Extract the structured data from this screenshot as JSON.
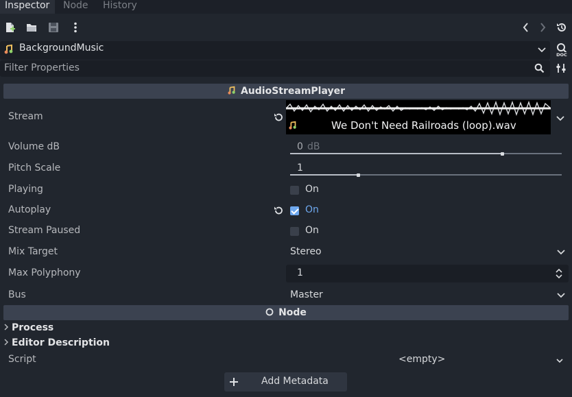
{
  "tabs": [
    {
      "label": "Inspector",
      "active": true
    },
    {
      "label": "Node",
      "active": false
    },
    {
      "label": "History",
      "active": false
    }
  ],
  "node": {
    "name": "BackgroundMusic"
  },
  "filter": {
    "placeholder": "Filter Properties"
  },
  "section_main": {
    "title": "AudioStreamPlayer"
  },
  "props": {
    "stream": {
      "label": "Stream",
      "value": "We Don't Need Railroads (loop).wav"
    },
    "volume_db": {
      "label": "Volume dB",
      "value": "0",
      "unit": "dB",
      "level": 0.78
    },
    "pitch_scale": {
      "label": "Pitch Scale",
      "value": "1",
      "level": 0.25
    },
    "playing": {
      "label": "Playing",
      "value": "On",
      "checked": false
    },
    "autoplay": {
      "label": "Autoplay",
      "value": "On",
      "checked": true
    },
    "stream_paused": {
      "label": "Stream Paused",
      "value": "On",
      "checked": false
    },
    "mix_target": {
      "label": "Mix Target",
      "value": "Stereo"
    },
    "max_polyphony": {
      "label": "Max Polyphony",
      "value": "1"
    },
    "bus": {
      "label": "Bus",
      "value": "Master"
    }
  },
  "section_node": {
    "title": "Node"
  },
  "groups": {
    "process": "Process",
    "editor_description": "Editor Description"
  },
  "script": {
    "label": "Script",
    "value": "<empty>"
  },
  "metadata": {
    "button_label": "Add Metadata"
  },
  "colors": {
    "accent": "#6ea8ee",
    "background": "#21262e",
    "section": "#3b4250"
  }
}
